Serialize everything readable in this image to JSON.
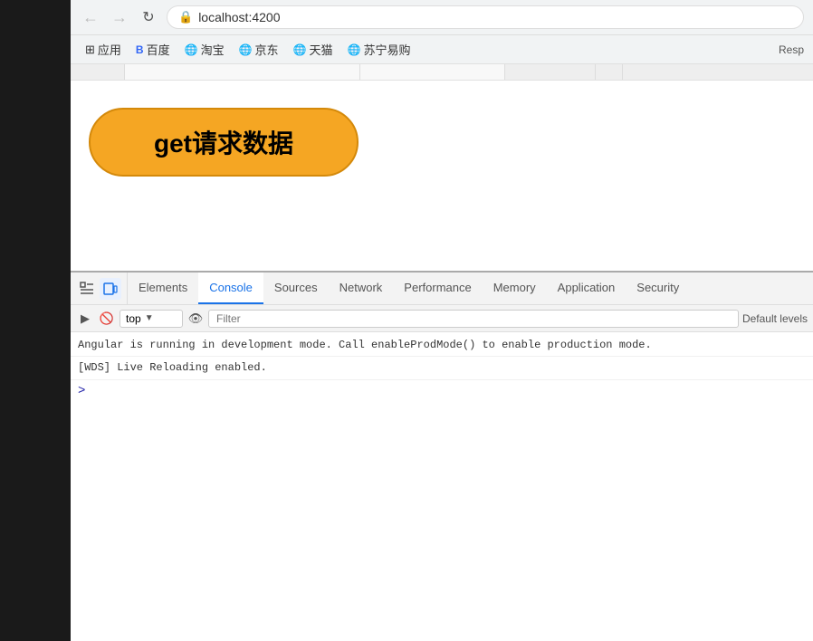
{
  "browser": {
    "url": "localhost:4200",
    "back_disabled": true,
    "forward_disabled": true,
    "bookmarks": [
      {
        "label": "应用",
        "icon": "⊞"
      },
      {
        "label": "百度",
        "icon": "🔵"
      },
      {
        "label": "淘宝",
        "icon": "🌐"
      },
      {
        "label": "京东",
        "icon": "🌐"
      },
      {
        "label": "天猫",
        "icon": "🌐"
      },
      {
        "label": "苏宁易购",
        "icon": "🌐"
      }
    ],
    "resp_label": "Resp"
  },
  "page": {
    "button_label": "get请求数据"
  },
  "devtools": {
    "tabs": [
      {
        "id": "elements",
        "label": "Elements",
        "active": false
      },
      {
        "id": "console",
        "label": "Console",
        "active": true
      },
      {
        "id": "sources",
        "label": "Sources",
        "active": false
      },
      {
        "id": "network",
        "label": "Network",
        "active": false
      },
      {
        "id": "performance",
        "label": "Performance",
        "active": false
      },
      {
        "id": "memory",
        "label": "Memory",
        "active": false
      },
      {
        "id": "application",
        "label": "Application",
        "active": false
      },
      {
        "id": "security",
        "label": "Security",
        "active": false
      }
    ],
    "console": {
      "context": "top",
      "filter_placeholder": "Filter",
      "default_levels_label": "Default levels",
      "lines": [
        "Angular is running in development mode. Call enableProdMode() to enable production mode.",
        "[WDS] Live Reloading enabled."
      ],
      "prompt": ">"
    }
  }
}
